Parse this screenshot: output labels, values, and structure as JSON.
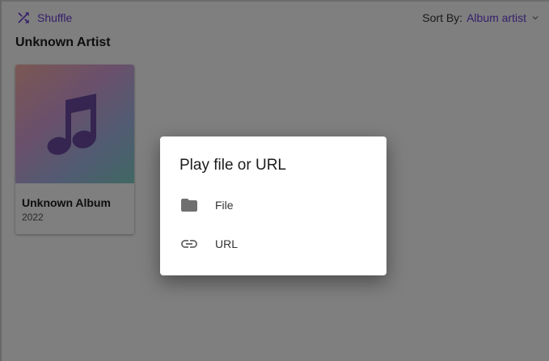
{
  "toolbar": {
    "shuffle_label": "Shuffle",
    "sort_prefix": "Sort By:",
    "sort_value": "Album artist"
  },
  "artist": {
    "name": "Unknown Artist"
  },
  "album": {
    "title": "Unknown Album",
    "year": "2022"
  },
  "dialog": {
    "title": "Play file or URL",
    "options": [
      {
        "label": "File",
        "icon": "folder-icon"
      },
      {
        "label": "URL",
        "icon": "link-icon"
      }
    ]
  },
  "colors": {
    "accent": "#6b3fd6",
    "scrim": "rgba(0,0,0,0.5)"
  }
}
